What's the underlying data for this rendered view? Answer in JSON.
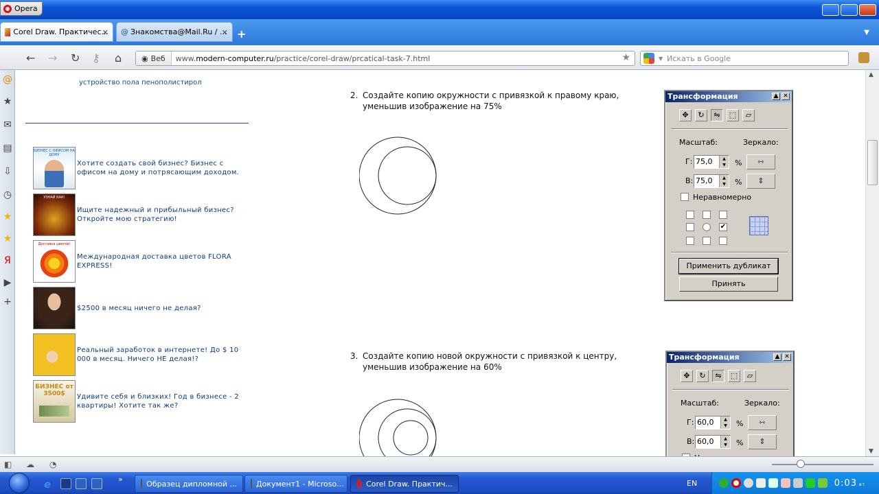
{
  "window": {
    "title": "Opera"
  },
  "tabs": [
    {
      "label": "Corel Draw. Практичес...",
      "active": true
    },
    {
      "label": "Знакомства@Mail.Ru / ...",
      "active": false
    }
  ],
  "newtab_symbol": "+",
  "address": {
    "badge": "Веб",
    "url_prefix": "www.",
    "url_domain": "modern-computer.ru",
    "url_path": "/practice/corel-draw/prcatical-task-7.html"
  },
  "search": {
    "placeholder": "Искать в Google"
  },
  "sidebar_left": {
    "top_link": "устройство пола пенополистирол",
    "ads": [
      {
        "text": "Хотите создать свой бизнес? Бизнес с офисом на дому и потрясающим доходом.",
        "img_caption": "БИЗНЕС С ОФИСОМ НА ДОМУ"
      },
      {
        "text": "Ищите надежный и прибыльный бизнес? Откройте мою стратегию!",
        "img_caption": "УЗНАЙ КАК!"
      },
      {
        "text": "Международная доставка цветов FLORA EXPRESS!",
        "img_caption": "Доставка цветов!"
      },
      {
        "text": "$2500 в месяц ничего не делая?",
        "img_caption": ""
      },
      {
        "text": "Реальный заработок в интернете! До $ 10 000 в месяц. Ничего НЕ делая!?",
        "img_caption": ""
      },
      {
        "text": "Удивите себя и близких! Год в бизнесе - 2 квартиры! Хотите так же?",
        "img_caption": "БИЗНЕС от 3500$"
      }
    ]
  },
  "steps": [
    {
      "num": "2.",
      "text": "Создайте копию окружности с привязкой к правому краю, уменьшив изображение на 75%"
    },
    {
      "num": "3.",
      "text": "Создайте копию новой окружности с привязкой к центру, уменьшив изображение на 60%"
    }
  ],
  "dialogs": [
    {
      "title": "Трансформация",
      "scale_label": "Масштаб:",
      "mirror_label": "Зеркало:",
      "h_label": "Г:",
      "h_value": "75,0",
      "v_label": "В:",
      "v_value": "75,0",
      "percent": "%",
      "nonuniform": "Неравномерно",
      "apply_dup": "Применить дубликат",
      "apply": "Принять"
    },
    {
      "title": "Трансформация",
      "scale_label": "Масштаб:",
      "mirror_label": "Зеркало:",
      "h_label": "Г:",
      "h_value": "60,0",
      "v_label": "В:",
      "v_value": "60,0",
      "percent": "%",
      "nonuniform": "Н"
    }
  ],
  "taskbar": {
    "items": [
      {
        "label": "Образец дипломной ...",
        "active": false
      },
      {
        "label": "Документ1 - Microso...",
        "active": false
      },
      {
        "label": "Corel Draw. Практич...",
        "active": true
      }
    ],
    "lang": "EN",
    "clock": "0:03",
    "day": "вт",
    "chevron": "»"
  }
}
